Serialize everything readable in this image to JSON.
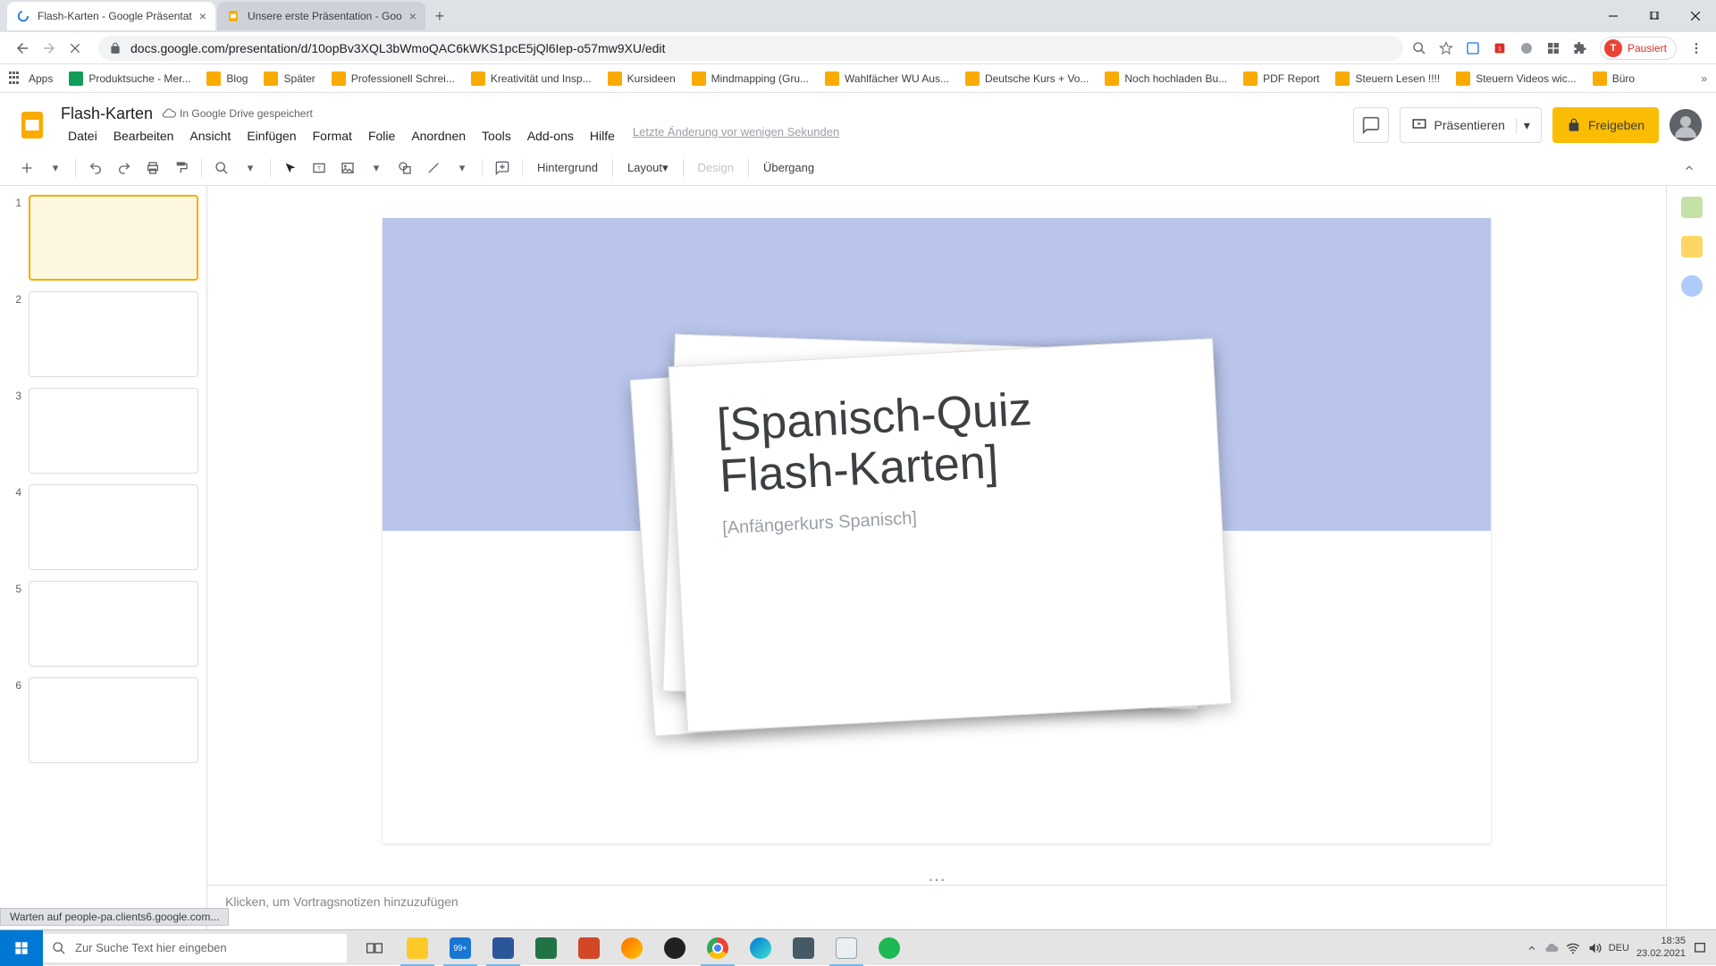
{
  "browser": {
    "tabs": [
      {
        "title": "Flash-Karten - Google Präsentat"
      },
      {
        "title": "Unsere erste Präsentation - Goo"
      }
    ],
    "url": "docs.google.com/presentation/d/10opBv3XQL3bWmoQAC6kWKS1pcE5jQl6Iep-o57mw9XU/edit",
    "pausiert": "Pausiert"
  },
  "bookmarks": {
    "apps": "Apps",
    "items": [
      "Produktsuche - Mer...",
      "Blog",
      "Später",
      "Professionell Schrei...",
      "Kreativität und Insp...",
      "Kursideen",
      "Mindmapping (Gru...",
      "Wahlfächer WU Aus...",
      "Deutsche Kurs + Vo...",
      "Noch hochladen Bu...",
      "PDF Report",
      "Steuern Lesen !!!!",
      "Steuern Videos wic...",
      "Büro"
    ]
  },
  "doc": {
    "title": "Flash-Karten",
    "status": "In Google Drive gespeichert",
    "last_edit": "Letzte Änderung vor wenigen Sekunden"
  },
  "menus": [
    "Datei",
    "Bearbeiten",
    "Ansicht",
    "Einfügen",
    "Format",
    "Folie",
    "Anordnen",
    "Tools",
    "Add-ons",
    "Hilfe"
  ],
  "header_buttons": {
    "present": "Präsentieren",
    "share": "Freigeben"
  },
  "toolbar": {
    "hintergrund": "Hintergrund",
    "layout": "Layout",
    "design": "Design",
    "uebergang": "Übergang"
  },
  "filmstrip": {
    "slides": [
      "1",
      "2",
      "3",
      "4",
      "5",
      "6"
    ]
  },
  "slide_content": {
    "title_line1": "[Spanisch-Quiz",
    "title_line2": "Flash-Karten]",
    "subtitle": "[Anfängerkurs Spanisch]"
  },
  "notes": {
    "placeholder": "Klicken, um Vortragsnotizen hinzuzufügen"
  },
  "status_loading": "Warten auf people-pa.clients6.google.com...",
  "taskbar": {
    "search_placeholder": "Zur Suche Text hier eingeben",
    "lang": "DEU",
    "time": "18:35",
    "date": "23.02.2021"
  }
}
